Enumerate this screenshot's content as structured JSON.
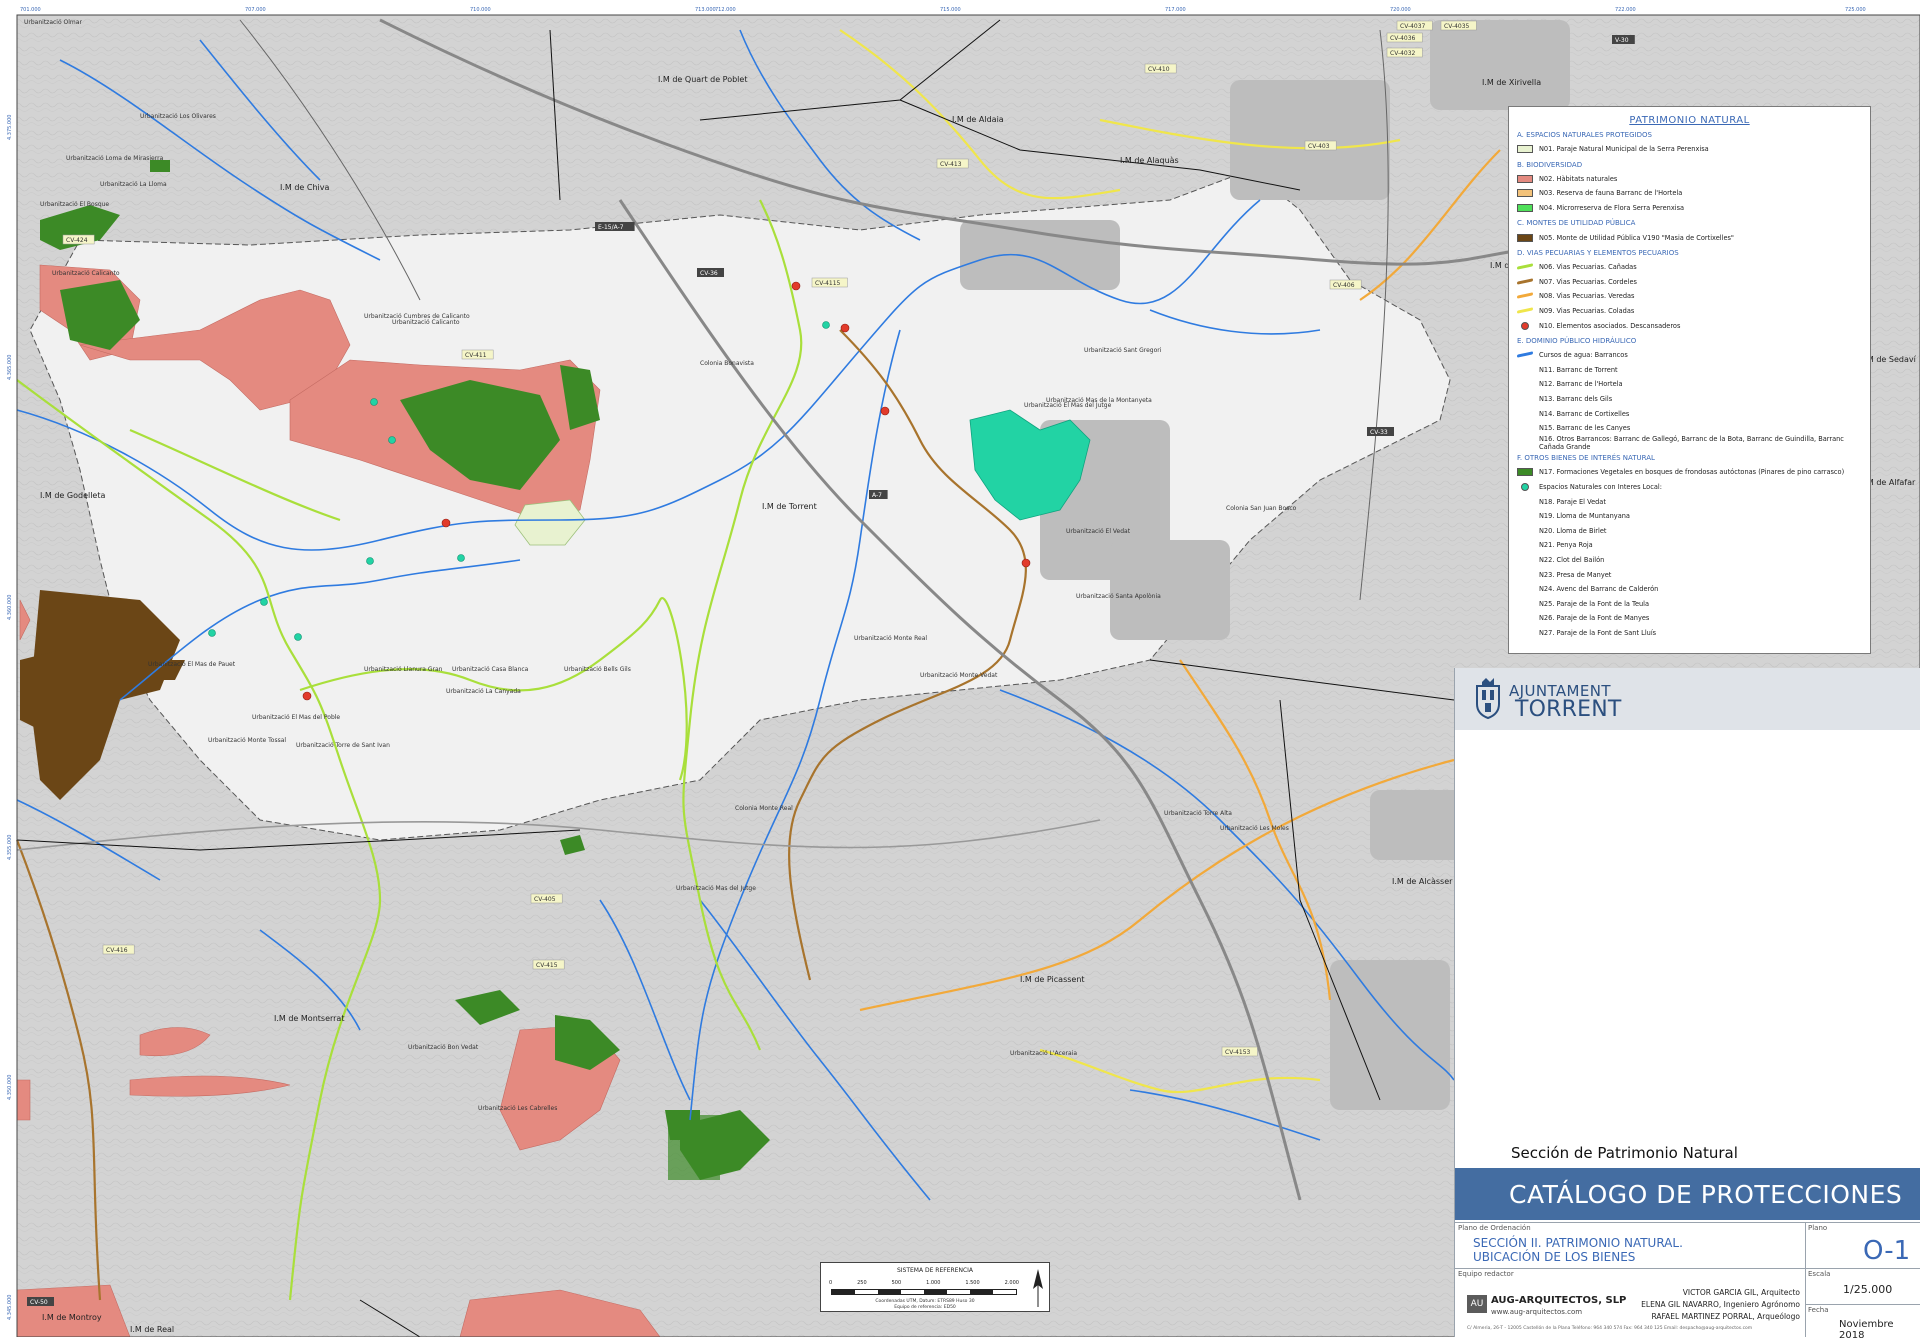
{
  "map": {
    "top_ticks": [
      "701.000",
      "707.000",
      "710.000",
      "713.000",
      "712.000",
      "715.000",
      "717.000",
      "720.000",
      "722.000",
      "725.000"
    ],
    "left_ticks": [
      "4.375.000",
      "4.365.000",
      "4.360.000",
      "4.355.000",
      "4.350.000",
      "4.345.000"
    ],
    "municipalities": [
      "I.M de Quart de Poblet",
      "I.M de Aldaia",
      "I.M de Alaquàs",
      "I.M de Xirivella",
      "I.M de Chiva",
      "I.M de Picanya",
      "I.M de Godelleta",
      "I.M de Torrent",
      "I.M de Alcàsser",
      "I.M de Montserrat",
      "I.M de Picassent",
      "I.M de Montroy",
      "I.M de Real",
      "I.M de Sedaví",
      "I.M de Alfafar"
    ],
    "roads": [
      "E-15/A-7",
      "CV-36",
      "CV-424",
      "CV-4115",
      "CV-411",
      "CV-413",
      "CV-410",
      "CV-403",
      "CV-405",
      "CV-415",
      "CV-416",
      "CV-4153",
      "CV-50",
      "CV-406",
      "CV-33",
      "A-7",
      "V-30",
      "CV-4037",
      "CV-4035",
      "CV-4036",
      "CV-4032"
    ],
    "places": [
      "Urbanització Olmar",
      "Urbanització Los Olivares",
      "Urbanització Loma de Mirasierra",
      "Urbanització La Lloma",
      "Urbanització El Bosque",
      "Urbanització Calicanto",
      "Urbanització Cumbres de Calicanto",
      "Colonia Bonavista",
      "Urbanització Santa Apolònia",
      "Urbanització El Mas del Jutge",
      "Colonia San Juan Bosco",
      "Urbanització El Vedat",
      "Urbanització Monte Real",
      "Urbanització Monte Vedat",
      "Urbanització Sant Gregori",
      "Urbanització Mas de la Montanyeta",
      "Urbanització Calicanto",
      "Urbanització El Mas de Pauet",
      "Urbanització Monte Tossal",
      "Urbanització Torre de Sant Ivan",
      "Urbanització La Canyada",
      "Urbanització Casa Blanca",
      "Urbanització Bells Gils",
      "Urbanització Llanura Gran",
      "Urbanització Torre Alta",
      "Urbanització El Mas del Poble",
      "Urbanització Les Cabrelles",
      "Urbanització Mas del Jutge",
      "Urbanització Les Moles",
      "Colonia Monte Real",
      "Urbanització L'Aceraia",
      "Urbanització Bon Vedat"
    ]
  },
  "legend": {
    "title": "PATRIMONIO NATURAL",
    "sections": [
      {
        "heading": "A. ESPACIOS NATURALES PROTEGIDOS",
        "items": [
          {
            "code": "N01. Paraje Natural Municipal de la Serra Perenxisa",
            "swatch": "fill",
            "color": "#e8f2d0"
          }
        ]
      },
      {
        "heading": "B. BIODIVERSIDAD",
        "items": [
          {
            "code": "N02. Hàbitats naturales",
            "swatch": "fill",
            "color": "#e48a80"
          },
          {
            "code": "N03. Reserva de fauna Barranc de l'Hortela",
            "swatch": "fill",
            "color": "#f3c27a"
          },
          {
            "code": "N04. Microrreserva de Flora Serra Perenxisa",
            "swatch": "fill",
            "color": "#4fe05a"
          }
        ]
      },
      {
        "heading": "C. MONTES DE UTILIDAD PÚBLICA",
        "items": [
          {
            "code": "N05. Monte de Utilidad Pública V190 \"Masia de Cortixelles\"",
            "swatch": "fill",
            "color": "#6b4616"
          }
        ]
      },
      {
        "heading": "D. VIAS PECUARIAS Y ELEMENTOS PECUARIOS",
        "items": [
          {
            "code": "N06. Vias Pecuarias. Cañadas",
            "swatch": "line",
            "color": "#a9df3b"
          },
          {
            "code": "N07. Vias Pecuarias. Cordeles",
            "swatch": "line",
            "color": "#a8742d"
          },
          {
            "code": "N08. Vias Pecuarias. Veredas",
            "swatch": "line",
            "color": "#f2a93a"
          },
          {
            "code": "N09. Vias Pecuarias. Coladas",
            "swatch": "line",
            "color": "#f0e64b"
          },
          {
            "code": "N10. Elementos asociados. Descansaderos",
            "swatch": "dot",
            "color": "#e23b2b"
          }
        ]
      },
      {
        "heading": "E. DOMINIO PÚBLICO HIDRÁULICO",
        "items": [
          {
            "code": "Cursos de agua: Barrancos",
            "swatch": "line",
            "color": "#2f7be0"
          },
          {
            "code": "N11. Barranc de Torrent",
            "swatch": "none",
            "color": ""
          },
          {
            "code": "N12. Barranc de l'Hortela",
            "swatch": "none",
            "color": ""
          },
          {
            "code": "N13. Barranc dels Gils",
            "swatch": "none",
            "color": ""
          },
          {
            "code": "N14. Barranc de Cortixelles",
            "swatch": "none",
            "color": ""
          },
          {
            "code": "N15. Barranc de les Canyes",
            "swatch": "none",
            "color": ""
          },
          {
            "code": "N16. Otros Barrancos: Barranc de Gallegó, Barranc de la Bota, Barranc de Guindilla, Barranc Cañada Grande",
            "swatch": "none",
            "color": ""
          }
        ]
      },
      {
        "heading": "F. OTROS BIENES DE INTERÉS NATURAL",
        "items": [
          {
            "code": "N17. Formaciones Vegetales en bosques de frondosas autóctonas (Pinares de pino carrasco)",
            "swatch": "fill",
            "color": "#3c8a26"
          },
          {
            "code": "Espacios Naturales con Interes Local:",
            "swatch": "dot",
            "color": "#22d3a4"
          },
          {
            "code": "N18. Paraje El Vedat",
            "swatch": "none",
            "color": ""
          },
          {
            "code": "N19. Lloma de Muntanyana",
            "swatch": "none",
            "color": ""
          },
          {
            "code": "N20. Lloma de Birlet",
            "swatch": "none",
            "color": ""
          },
          {
            "code": "N21. Penya Roja",
            "swatch": "none",
            "color": ""
          },
          {
            "code": "N22. Clot del Bailón",
            "swatch": "none",
            "color": ""
          },
          {
            "code": "N23. Presa de Manyet",
            "swatch": "none",
            "color": ""
          },
          {
            "code": "N24. Avenc del Barranc de Calderón",
            "swatch": "none",
            "color": ""
          },
          {
            "code": "N25. Paraje de la Font de la Teula",
            "swatch": "none",
            "color": ""
          },
          {
            "code": "N26. Paraje de la Font de Manyes",
            "swatch": "none",
            "color": ""
          },
          {
            "code": "N27. Paraje de la Font de Sant Lluís",
            "swatch": "none",
            "color": ""
          }
        ]
      }
    ]
  },
  "title_block": {
    "logo_line1": "AJUNTAMENT",
    "logo_line2": "TORRENT",
    "section_title": "Sección de Patrimonio Natural",
    "catalog_title": "CATÁLOGO DE PROTECCIONES",
    "plano_label": "Plano de Ordenación",
    "plano_text_1": "SECCIÓN II. PATRIMONIO NATURAL.",
    "plano_text_2": "UBICACIÓN DE LOS BIENES",
    "plano_num_label": "Plano",
    "plano_code": "O-1",
    "equipo_label": "Equipo redactor",
    "escala_label": "Escala",
    "escala_value": "1/25.000",
    "fecha_label": "Fecha",
    "fecha_value": "Noviembre 2018",
    "team": [
      "VICTOR GARCIA GIL, Arquitecto",
      "ELENA GIL NAVARRO, Ingeniero Agrónomo",
      "RAFAEL MARTINEZ PORRAL, Arqueólogo"
    ],
    "firm_initials": "AU",
    "firm_name": "AUG-ARQUITECTOS, SLP",
    "firm_web": "www.aug-arquitectos.com",
    "footer": "C/ Almeria, 26-T - 12005 Castellón de la Plana   Teléfono: 964 340 574   Fax: 964 340 125   Email: despacho@aug-arquitectos.com"
  },
  "scale": {
    "title": "SISTEMA DE REFERENCIA",
    "numbers": [
      "0",
      "250",
      "500",
      "1.000",
      "1.500",
      "2.000"
    ],
    "caption1": "Coordenadas UTM, Datum: ETRS89 Huso 30",
    "caption2": "Equipo de referencia: ED50"
  },
  "colors": {
    "habitat": "#e48a80",
    "forest": "#3c8a26",
    "monte": "#6b4616",
    "protected": "#e8f2d0",
    "interest": "#22d3a4",
    "river": "#2f7be0",
    "canada": "#a9df3b",
    "cordel": "#a8742d",
    "vereda": "#f2a93a",
    "colada": "#f0e64b",
    "header_blue": "#446da1"
  }
}
